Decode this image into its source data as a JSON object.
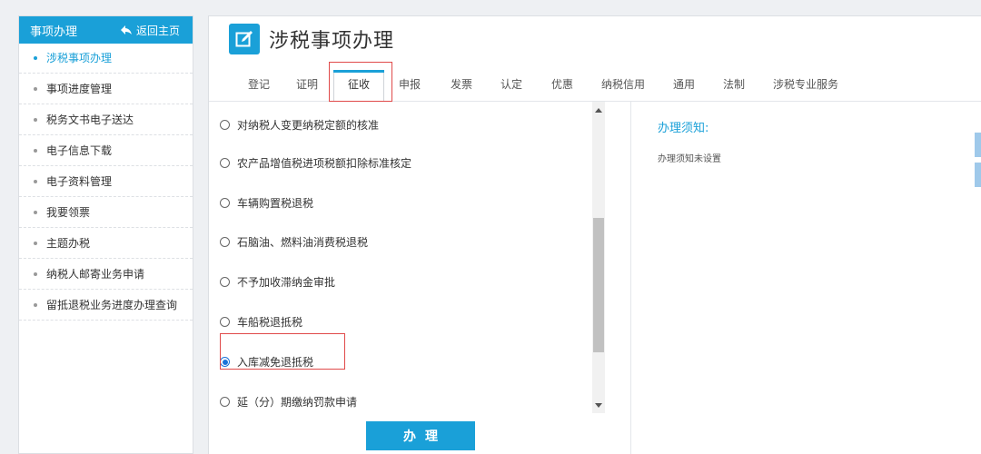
{
  "sidebar": {
    "title": "事项办理",
    "back_label": "返回主页",
    "items": [
      {
        "label": "涉税事项办理",
        "active": true
      },
      {
        "label": "事项进度管理"
      },
      {
        "label": "税务文书电子送达"
      },
      {
        "label": "电子信息下载"
      },
      {
        "label": "电子资料管理"
      },
      {
        "label": "我要领票"
      },
      {
        "label": "主题办税"
      },
      {
        "label": "纳税人邮寄业务申请"
      },
      {
        "label": "留抵退税业务进度办理查询"
      }
    ]
  },
  "main": {
    "title": "涉税事项办理",
    "tabs": [
      {
        "label": "登记"
      },
      {
        "label": "证明"
      },
      {
        "label": "征收",
        "active": true
      },
      {
        "label": "申报"
      },
      {
        "label": "发票"
      },
      {
        "label": "认定"
      },
      {
        "label": "优惠"
      },
      {
        "label": "纳税信用"
      },
      {
        "label": "通用"
      },
      {
        "label": "法制"
      },
      {
        "label": "涉税专业服务"
      }
    ],
    "options": [
      {
        "label": "对纳税人变更纳税定额的核准",
        "checked": false
      },
      {
        "label": "农产品增值税进项税额扣除标准核定",
        "checked": false
      },
      {
        "label": "车辆购置税退税",
        "checked": false
      },
      {
        "label": "石脑油、燃料油消费税退税",
        "checked": false
      },
      {
        "label": "不予加收滞纳金审批",
        "checked": false
      },
      {
        "label": "车船税退抵税",
        "checked": false
      },
      {
        "label": "入库减免退抵税",
        "checked": true
      },
      {
        "label": "延（分）期缴纳罚款申请",
        "checked": false
      }
    ],
    "notes_title": "办理须知:",
    "notes_text": "办理须知未设置",
    "action_label": "办理"
  },
  "colors": {
    "accent": "#1aa0d8",
    "highlight_border": "#e04a4a",
    "radio_checked": "#1a73d9"
  }
}
